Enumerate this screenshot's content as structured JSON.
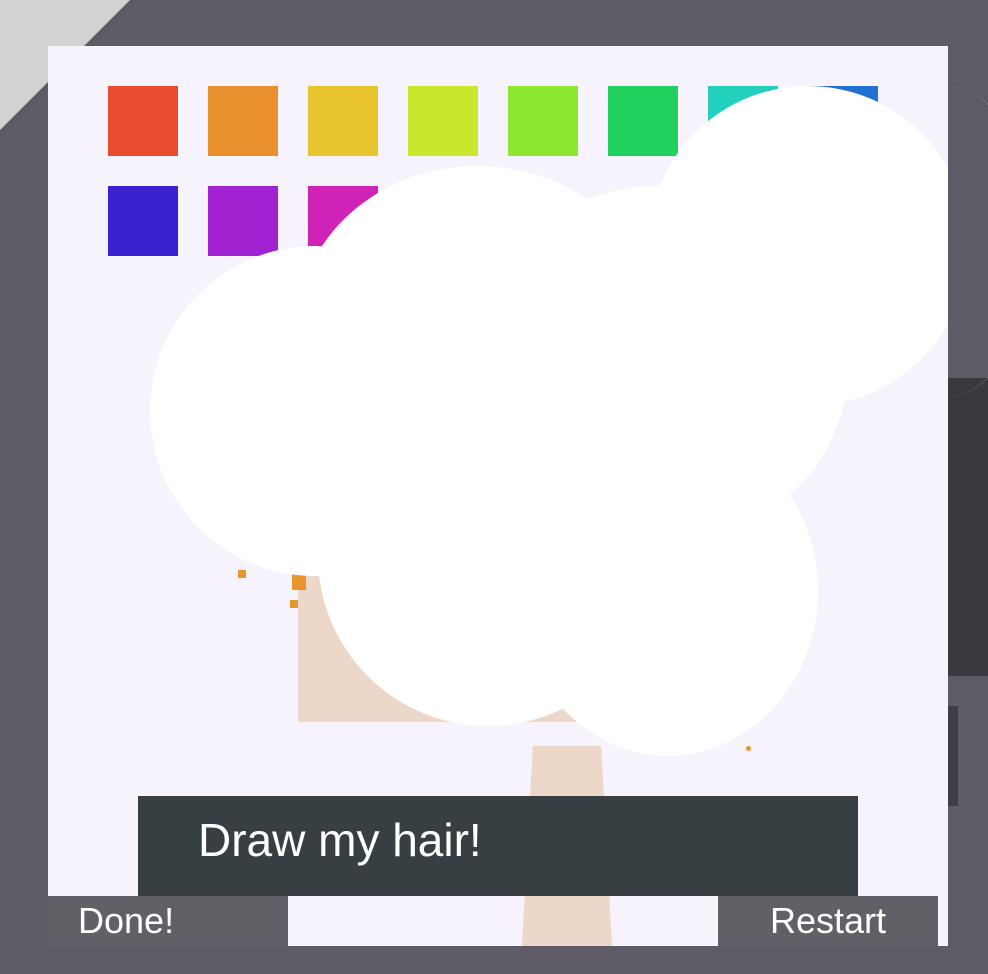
{
  "palette": {
    "row1": [
      "#e84c2e",
      "#e8902e",
      "#e8c52e",
      "#c8e82e",
      "#8ce82e",
      "#22d15d",
      "#22d1bd",
      "#2270d1"
    ],
    "row2": [
      "#3b22d1",
      "#a022d1",
      "#d122b8"
    ]
  },
  "drawing": {
    "skin_color": "#ecd7c9",
    "fill_color": "#ffffff",
    "speck_color": "#e8952e"
  },
  "dialog": {
    "text": "Draw my hair!"
  },
  "buttons": {
    "done_label": "Done!",
    "restart_label": "Restart"
  }
}
